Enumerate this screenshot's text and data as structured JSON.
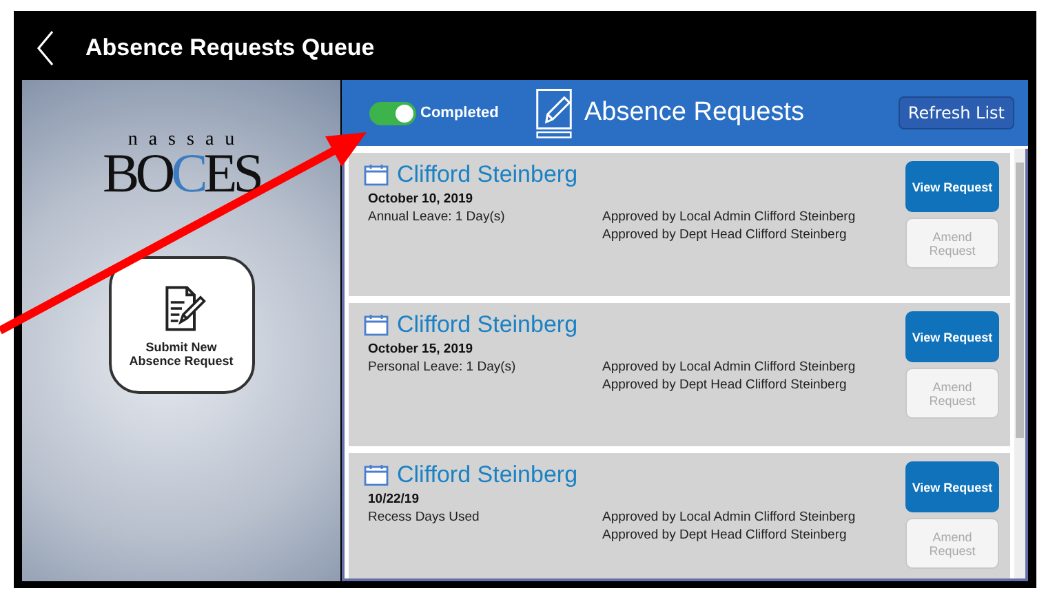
{
  "window": {
    "title": "Absence Requests Queue"
  },
  "logo": {
    "top": "nassau",
    "parts": [
      {
        "text": "BO",
        "color": "#111111"
      },
      {
        "text": "C",
        "color": "#3d7cc0"
      },
      {
        "text": "ES",
        "color": "#111111"
      }
    ]
  },
  "submit_button": {
    "label": "Submit New Absence Request"
  },
  "header": {
    "toggle": {
      "label": "Completed",
      "on": true
    },
    "title": "Absence Requests",
    "refresh_button": "Refresh List"
  },
  "requests": [
    {
      "name": "Clifford Steinberg",
      "date": "October 10, 2019",
      "leave": "Annual Leave: 1 Day(s)",
      "approvals": [
        "Approved by Local Admin Clifford Steinberg",
        "Approved by Dept Head Clifford Steinberg"
      ],
      "view_button": "View Request",
      "amend_button": {
        "label": "Amend Request",
        "disabled": true
      }
    },
    {
      "name": "Clifford Steinberg",
      "date": "October 15, 2019",
      "leave": "Personal Leave: 1 Day(s)",
      "approvals": [
        "Approved by Local Admin Clifford Steinberg",
        "Approved by Dept Head Clifford Steinberg"
      ],
      "view_button": "View Request",
      "amend_button": {
        "label": "Amend Request",
        "disabled": true
      }
    },
    {
      "name": "Clifford Steinberg",
      "date": "10/22/19",
      "leave": "Recess Days Used",
      "approvals": [
        "Approved by Local Admin Clifford Steinberg",
        "Approved by Dept Head Clifford Steinberg"
      ],
      "view_button": "View Request",
      "amend_button": {
        "label": "Amend Request",
        "disabled": true
      }
    }
  ]
}
